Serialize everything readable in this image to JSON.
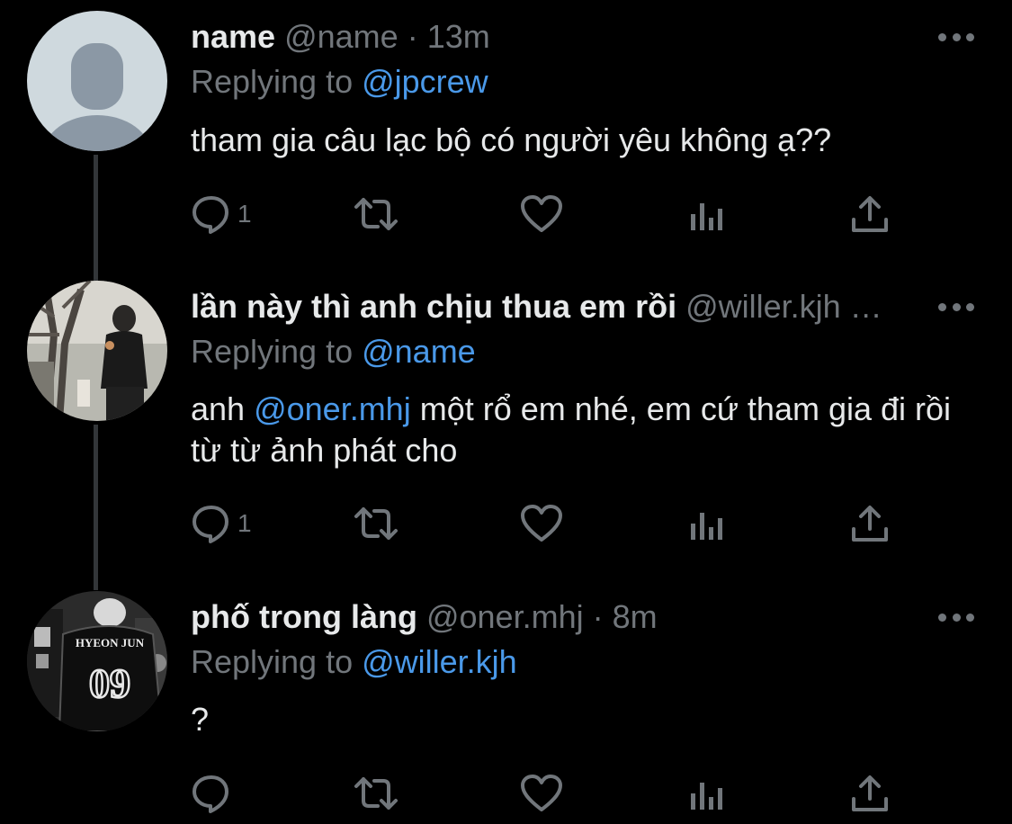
{
  "tweets": [
    {
      "display_name": "name",
      "handle": "@name",
      "separator": "·",
      "time": "13m",
      "replying_prefix": "Replying to ",
      "replying_to": "@jpcrew",
      "text": "tham gia câu lạc bộ có người yêu không ạ??",
      "reply_count": "1",
      "avatar": "default-profile-icon"
    },
    {
      "display_name": "lần này thì anh chịu thua em rồi",
      "handle": "@willer.kjh …",
      "replying_prefix": "Replying to ",
      "replying_to": "@name",
      "text_before": "anh ",
      "text_mention": "@oner.mhj",
      "text_after": " một rổ em nhé, em cứ tham gia đi rồi từ từ ảnh phát cho",
      "reply_count": "1",
      "avatar": "photo-man-by-tree"
    },
    {
      "display_name": "phố trong làng",
      "handle": "@oner.mhj",
      "separator": "·",
      "time": "8m",
      "replying_prefix": "Replying to ",
      "replying_to": "@willer.kjh",
      "text": "?",
      "reply_count": "",
      "avatar": "photo-jersey",
      "avatar_jersey_name": "HYEON JUN",
      "avatar_jersey_number": "09"
    }
  ],
  "colors": {
    "background": "#000000",
    "text": "#e7e9ea",
    "secondary": "#71767b",
    "link": "#4a99e9",
    "thread_line": "#333639"
  }
}
